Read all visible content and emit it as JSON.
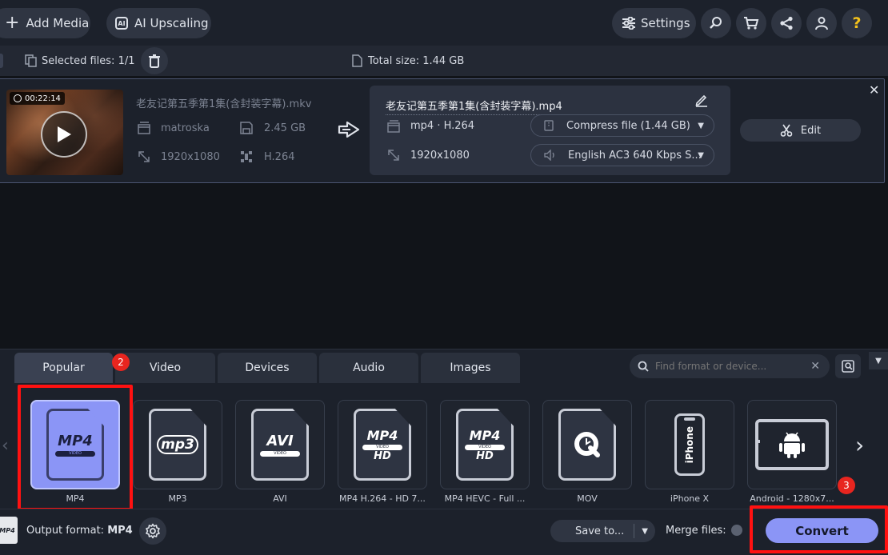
{
  "topbar": {
    "add_media": "Add Media",
    "ai_upscaling": "AI Upscaling",
    "settings": "Settings",
    "help": "?"
  },
  "subbar": {
    "selected_files": "Selected files: 1/1",
    "total_size_label": "Total size: ",
    "total_size_value": "1.44 GB"
  },
  "file": {
    "duration": "00:22:14",
    "source_name": "老友记第五季第1集(含封装字幕).mkv",
    "container": "matroska",
    "size": "2.45 GB",
    "resolution": "1920x1080",
    "codec": "H.264",
    "output_name": "老友记第五季第1集(含封装字幕).mp4",
    "output_format": "mp4 · H.264",
    "output_resolution": "1920x1080",
    "compress": "Compress file (1.44 GB)",
    "audio": "English AC3 640 Kbps S...",
    "edit": "Edit"
  },
  "tabs": [
    {
      "label": "Popular"
    },
    {
      "label": "Video"
    },
    {
      "label": "Devices"
    },
    {
      "label": "Audio"
    },
    {
      "label": "Images"
    }
  ],
  "search": {
    "placeholder": "Find format or device..."
  },
  "formats": [
    {
      "label": "MP4",
      "icon": "MP4"
    },
    {
      "label": "MP3",
      "icon": "mp3"
    },
    {
      "label": "AVI",
      "icon": "AVI"
    },
    {
      "label": "MP4 H.264 - HD 7...",
      "icon": "MP4 HD"
    },
    {
      "label": "MP4 HEVC - Full ...",
      "icon": "MP4 HD"
    },
    {
      "label": "MOV",
      "icon": "quicktime"
    },
    {
      "label": "iPhone X",
      "icon": "iPhone"
    },
    {
      "label": "Android - 1280x7...",
      "icon": "android"
    }
  ],
  "bottom": {
    "output_format_label": "Output format: ",
    "output_format_value": "MP4",
    "format_icon_text": "MP4",
    "save_to": "Save to...",
    "merge_files": "Merge files:",
    "convert": "Convert"
  },
  "badges": [
    "2",
    "3"
  ],
  "colors": {
    "accent": "#8b95f6",
    "highlight": "#ff1111",
    "badge": "#e8251f"
  }
}
